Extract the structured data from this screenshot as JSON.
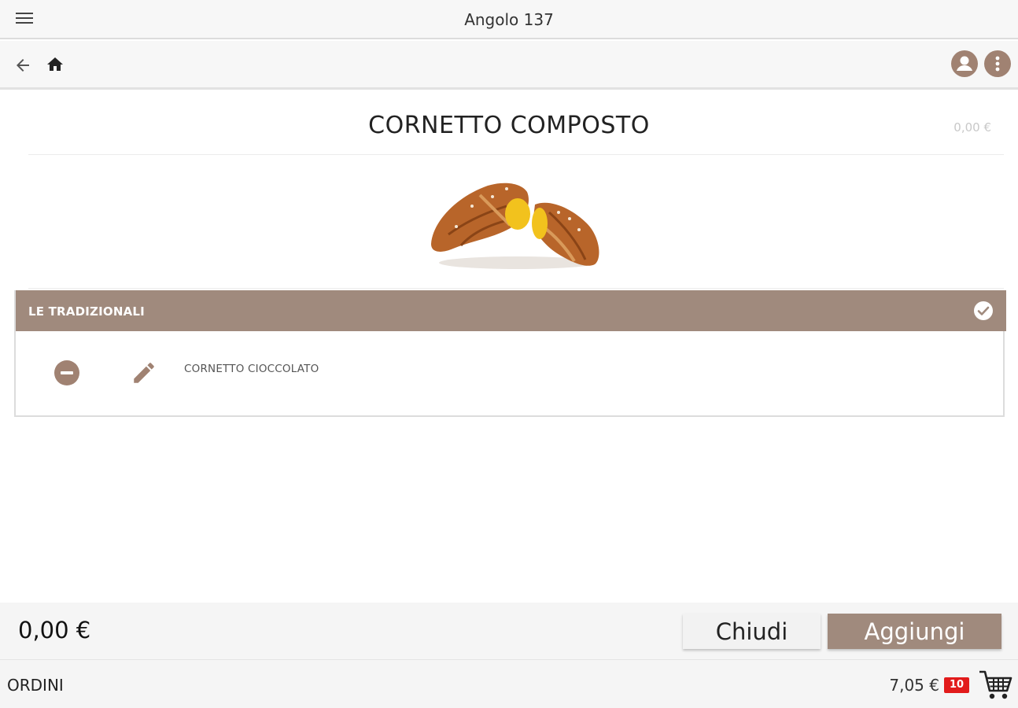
{
  "app": {
    "title": "Angolo 137"
  },
  "icons": {
    "menu": "menu-icon",
    "back": "back-arrow-icon",
    "home": "home-icon",
    "user": "user-icon",
    "more": "more-vertical-icon",
    "check": "check-circle-icon",
    "remove": "remove-circle-icon",
    "edit": "pencil-icon",
    "cart": "cart-icon"
  },
  "product": {
    "name": "CORNETTO COMPOSTO",
    "price": "0,00 €"
  },
  "section": {
    "label": "LE TRADIZIONALI",
    "items": [
      {
        "label": "CORNETTO CIOCCOLATO"
      }
    ]
  },
  "actions": {
    "total": "0,00 €",
    "close_label": "Chiudi",
    "add_label": "Aggiungi"
  },
  "orders": {
    "label": "ORDINI",
    "total": "7,05 €",
    "count": "10"
  },
  "colors": {
    "accent": "#a08a7d",
    "icon_brown": "#a08272",
    "badge_red": "#e21b1b"
  }
}
